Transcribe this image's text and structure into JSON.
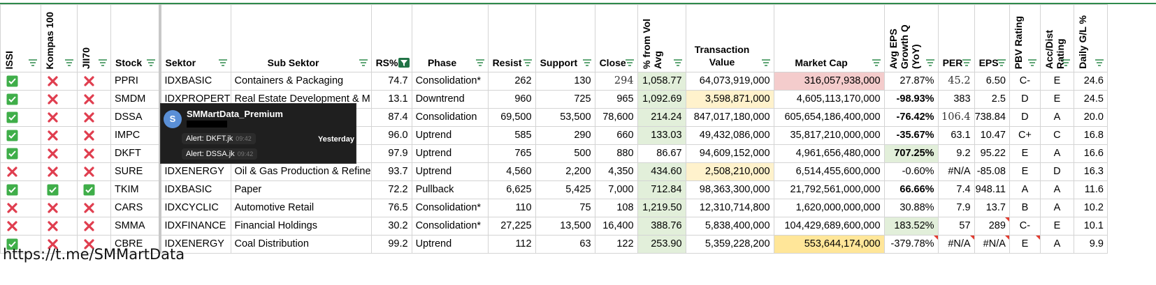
{
  "columns": [
    {
      "key": "issi",
      "label": "ISSI",
      "vertical": true
    },
    {
      "key": "kompas",
      "label": "Kompas 100",
      "vertical": true
    },
    {
      "key": "jii70",
      "label": "JII70",
      "vertical": true
    },
    {
      "key": "stock",
      "label": "Stock"
    },
    {
      "key": "sektor",
      "label": "Sektor"
    },
    {
      "key": "sub",
      "label": "Sub Sektor"
    },
    {
      "key": "rs",
      "label": "RS%",
      "filtered": true
    },
    {
      "key": "phase",
      "label": "Phase"
    },
    {
      "key": "resist",
      "label": "Resist"
    },
    {
      "key": "support",
      "label": "Support"
    },
    {
      "key": "close",
      "label": "Close"
    },
    {
      "key": "fromvol",
      "label": "% from Vol Avg",
      "vertical": true
    },
    {
      "key": "trans",
      "label": "Transaction Value",
      "wrap": true
    },
    {
      "key": "mcap",
      "label": "Market Cap"
    },
    {
      "key": "epsg",
      "label": "Avg EPS Growth Q (YoY)",
      "vertical": true
    },
    {
      "key": "per",
      "label": "PER"
    },
    {
      "key": "eps",
      "label": "EPS"
    },
    {
      "key": "pbv",
      "label": "PBV Rating",
      "vertical": true
    },
    {
      "key": "accdist",
      "label": "Acc/Dist Rating",
      "vertical": true
    },
    {
      "key": "daily",
      "label": "Daily G/L %",
      "vertical": true
    }
  ],
  "rows": [
    {
      "issi": "check",
      "kompas": "cross",
      "jii70": "cross",
      "stock": "PPRI",
      "sektor": "IDXBASIC",
      "sub": "Containers & Packaging",
      "rs": "74.7",
      "phase": "Consolidation*",
      "resist": "262",
      "support": "130",
      "close": "294",
      "fromvol": "1,058.77",
      "trans": "64,073,919,000",
      "mcap": "316,057,938,000",
      "epsg": "27.87%",
      "per": "45.2",
      "eps": "6.50",
      "pbv": "C-",
      "accdist": "E",
      "daily": "24.6"
    },
    {
      "issi": "check",
      "kompas": "cross",
      "jii70": "cross",
      "stock": "SMDM",
      "sektor": "IDXPROPERT",
      "sub": "Real Estate Development & M",
      "rs": "13.1",
      "phase": "Downtrend",
      "resist": "960",
      "support": "725",
      "close": "965",
      "fromvol": "1,092.69",
      "trans": "3,598,871,000",
      "mcap": "4,605,113,170,000",
      "epsg": "-98.93%",
      "per": "383",
      "eps": "2.5",
      "pbv": "D",
      "accdist": "E",
      "daily": "24.5"
    },
    {
      "issi": "check",
      "kompas": "cross",
      "jii70": "cross",
      "stock": "DSSA",
      "sektor": "",
      "sub": "",
      "rs": "87.4",
      "phase": "Consolidation",
      "resist": "69,500",
      "support": "53,500",
      "close": "78,600",
      "fromvol": "214.24",
      "trans": "847,017,180,000",
      "mcap": "605,654,186,400,000",
      "epsg": "-76.42%",
      "per": "106.4",
      "eps": "738.84",
      "pbv": "D",
      "accdist": "A",
      "daily": "20.0"
    },
    {
      "issi": "check",
      "kompas": "cross",
      "jii70": "cross",
      "stock": "IMPC",
      "sektor": "",
      "sub": "",
      "rs": "96.0",
      "phase": "Uptrend",
      "resist": "585",
      "support": "290",
      "close": "660",
      "fromvol": "133.03",
      "trans": "49,432,086,000",
      "mcap": "35,817,210,000,000",
      "epsg": "-35.67%",
      "per": "63.1",
      "eps": "10.47",
      "pbv": "C+",
      "accdist": "C",
      "daily": "16.8"
    },
    {
      "issi": "check",
      "kompas": "cross",
      "jii70": "cross",
      "stock": "DKFT",
      "sektor": "",
      "sub": "",
      "rs": "97.9",
      "phase": "Uptrend",
      "resist": "765",
      "support": "500",
      "close": "880",
      "fromvol": "86.67",
      "trans": "94,609,152,000",
      "mcap": "4,961,656,480,000",
      "epsg": "707.25%",
      "per": "9.2",
      "eps": "95.22",
      "pbv": "E",
      "accdist": "A",
      "daily": "16.6"
    },
    {
      "issi": "cross",
      "kompas": "cross",
      "jii70": "cross",
      "stock": "SURE",
      "sektor": "IDXENERGY",
      "sub": "Oil & Gas Production & Refine",
      "rs": "93.7",
      "phase": "Uptrend",
      "resist": "4,560",
      "support": "2,200",
      "close": "4,350",
      "fromvol": "434.60",
      "trans": "2,508,210,000",
      "mcap": "6,514,455,600,000",
      "epsg": "-0.60%",
      "per": "#N/A",
      "eps": "-85.08",
      "pbv": "E",
      "accdist": "D",
      "daily": "16.3"
    },
    {
      "issi": "check",
      "kompas": "check",
      "jii70": "check",
      "stock": "TKIM",
      "sektor": "IDXBASIC",
      "sub": "Paper",
      "rs": "72.2",
      "phase": "Pullback",
      "resist": "6,625",
      "support": "5,425",
      "close": "7,000",
      "fromvol": "712.84",
      "trans": "98,363,300,000",
      "mcap": "21,792,561,000,000",
      "epsg": "66.66%",
      "per": "7.4",
      "eps": "948.11",
      "pbv": "A",
      "accdist": "A",
      "daily": "11.6"
    },
    {
      "issi": "cross",
      "kompas": "cross",
      "jii70": "cross",
      "stock": "CARS",
      "sektor": "IDXCYCLIC",
      "sub": "Automotive Retail",
      "rs": "76.5",
      "phase": "Consolidation*",
      "resist": "110",
      "support": "75",
      "close": "108",
      "fromvol": "1,219.50",
      "trans": "12,310,714,800",
      "mcap": "1,620,000,000,000",
      "epsg": "30.88%",
      "per": "7.9",
      "eps": "13.7",
      "pbv": "B",
      "accdist": "A",
      "daily": "10.2"
    },
    {
      "issi": "cross",
      "kompas": "cross",
      "jii70": "cross",
      "stock": "SMMA",
      "sektor": "IDXFINANCE",
      "sub": "Financial Holdings",
      "rs": "30.2",
      "phase": "Consolidation*",
      "resist": "27,225",
      "support": "13,500",
      "close": "16,400",
      "fromvol": "388.76",
      "trans": "5,838,400,000",
      "mcap": "104,429,689,600,000",
      "epsg": "183.52%",
      "per": "57",
      "eps": "289",
      "pbv": "C-",
      "accdist": "E",
      "daily": "10.1"
    },
    {
      "issi": "check",
      "kompas": "cross",
      "jii70": "cross",
      "stock": "CBRE",
      "sektor": "IDXENERGY",
      "sub": "Coal Distribution",
      "rs": "99.2",
      "phase": "Uptrend",
      "resist": "112",
      "support": "63",
      "close": "122",
      "fromvol": "253.90",
      "trans": "5,359,228,200",
      "mcap": "553,644,174,000",
      "epsg": "-379.78%",
      "per": "#N/A",
      "eps": "#N/A",
      "pbv": "E",
      "accdist": "A",
      "daily": "9.9"
    }
  ],
  "popup": {
    "avatar_letter": "S",
    "channel": "SMMartData_Premium",
    "messages": [
      {
        "text": "Alert: DKFT.jk",
        "time": "09:42"
      },
      {
        "text": "Alert: DSSA.jk",
        "time": "09:42"
      }
    ],
    "when": "Yesterday"
  },
  "footer": {
    "link": "https://t.me/SMMartData"
  },
  "colors": {
    "check": "#3fae49",
    "cross": "#e03e4f",
    "filter_active": "#217346",
    "green_fill": "#e2efda",
    "yellow_fill": "#fff2cc",
    "red_fill": "#f4cccc"
  }
}
